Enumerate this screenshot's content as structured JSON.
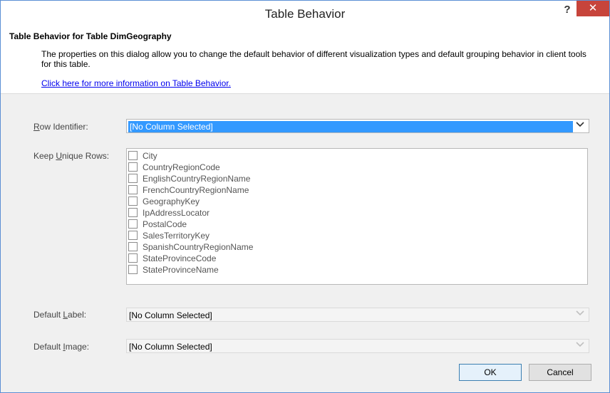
{
  "window": {
    "title": "Table Behavior",
    "help_label": "?",
    "close_label": "✕"
  },
  "header": {
    "title": "Table Behavior for Table DimGeography",
    "description": "The properties on this dialog allow you to change the default behavior of different visualization types and default grouping behavior in client tools for this table.",
    "link": "Click here for more information on Table Behavior."
  },
  "row_identifier": {
    "label_pre": "",
    "label_key": "R",
    "label_post": "ow Identifier:",
    "value": "[No Column Selected]"
  },
  "keep_unique_rows": {
    "label_pre": "Keep ",
    "label_key": "U",
    "label_post": "nique Rows:",
    "items": [
      "City",
      "CountryRegionCode",
      "EnglishCountryRegionName",
      "FrenchCountryRegionName",
      "GeographyKey",
      "IpAddressLocator",
      "PostalCode",
      "SalesTerritoryKey",
      "SpanishCountryRegionName",
      "StateProvinceCode",
      "StateProvinceName"
    ]
  },
  "default_label": {
    "label_pre": "Default ",
    "label_key": "L",
    "label_post": "abel:",
    "value": "[No Column Selected]"
  },
  "default_image": {
    "label_pre": "Default ",
    "label_key": "I",
    "label_post": "mage:",
    "value": "[No Column Selected]"
  },
  "buttons": {
    "ok": "OK",
    "cancel": "Cancel"
  }
}
